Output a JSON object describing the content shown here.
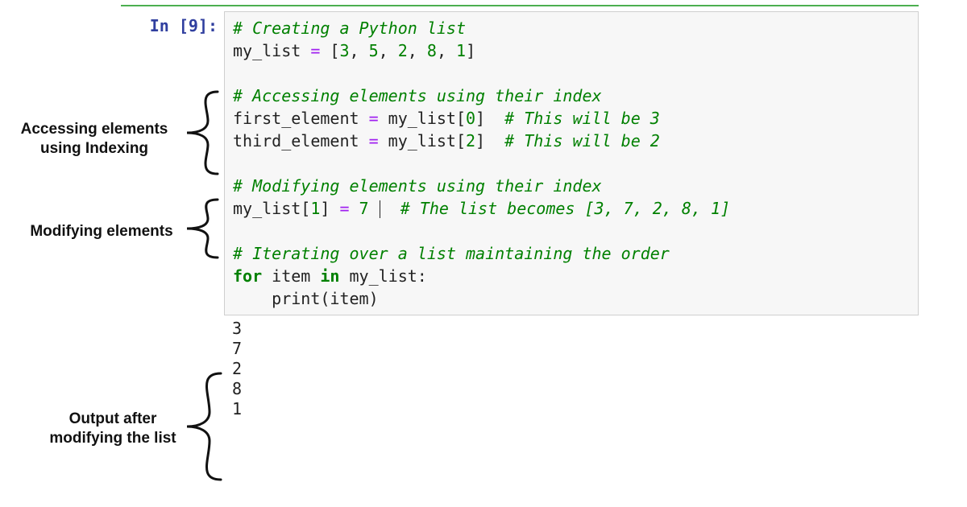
{
  "prompt": "In [9]:",
  "code": {
    "l1_comment": "# Creating a Python list",
    "l2_lhs": "my_list",
    "l2_eq": " = ",
    "l2_rhs_open": "[",
    "l2_vals": [
      "3",
      "5",
      "2",
      "8",
      "1"
    ],
    "l2_rhs_close": "]",
    "blank": "",
    "l3_comment": "# Accessing elements using their index",
    "l4_lhs": "first_element",
    "l4_eq": " = ",
    "l4_rhs": "my_list[",
    "l4_idx": "0",
    "l4_rhs_close": "]",
    "l4_trail": "  # This will be 3",
    "l5_lhs": "third_element",
    "l5_eq": " = ",
    "l5_rhs": "my_list[",
    "l5_idx": "2",
    "l5_rhs_close": "]",
    "l5_trail": "  # This will be 2",
    "l6_comment": "# Modifying elements using their index",
    "l7_lhs": "my_list[",
    "l7_idx": "1",
    "l7_lhs_close": "]",
    "l7_eq": " = ",
    "l7_val": "7",
    "l7_trail": "  # The list becomes [3, 7, 2, 8, 1]",
    "l8_comment": "# Iterating over a list maintaining the order",
    "l9_for": "for",
    "l9_item": " item ",
    "l9_in": "in",
    "l9_target": " my_list:",
    "l10_indent": "    ",
    "l10_func": "print",
    "l10_arg": "(item)"
  },
  "output_lines": [
    "3",
    "7",
    "2",
    "8",
    "1"
  ],
  "annotations": {
    "a1": "Accessing elements\nusing Indexing",
    "a2": "Modifying elements",
    "a3": "Output after\nmodifying the list"
  }
}
